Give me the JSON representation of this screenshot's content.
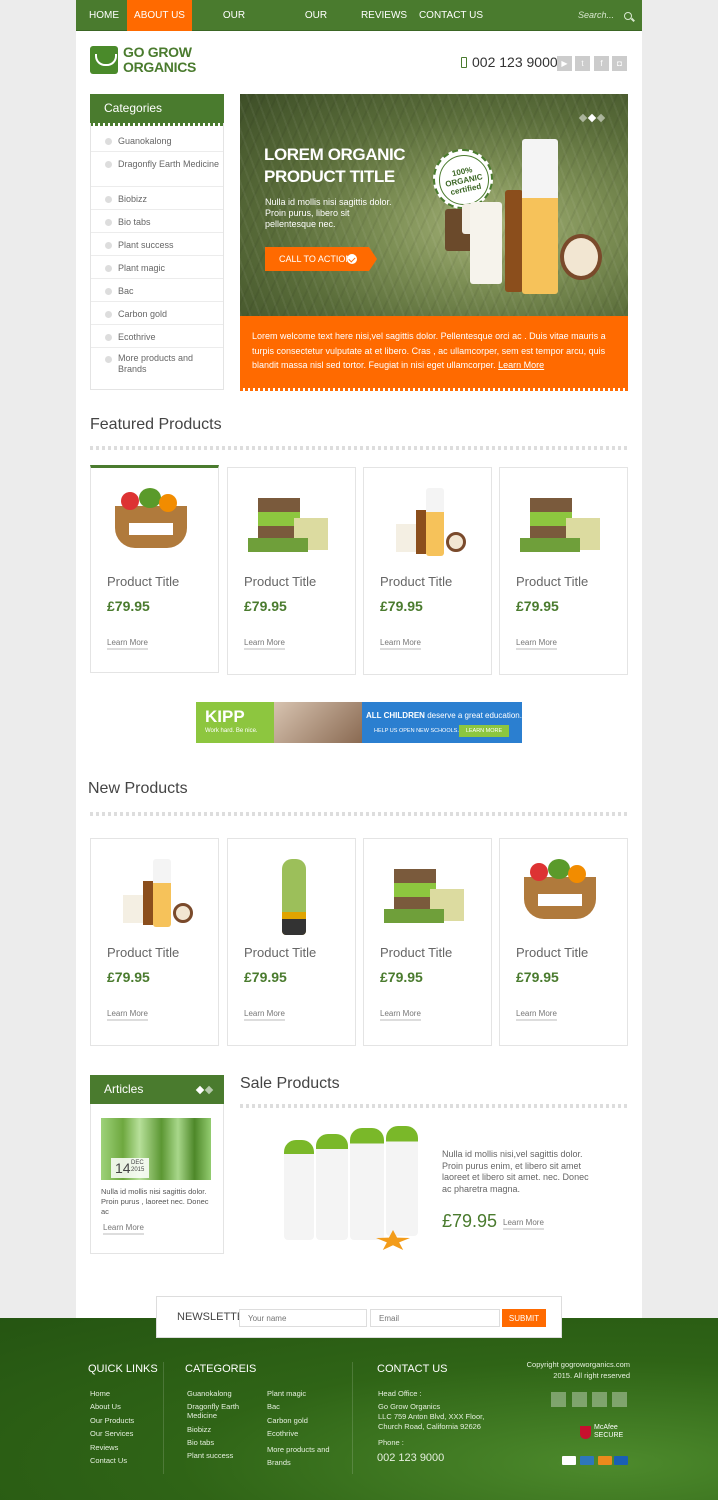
{
  "nav": {
    "items": [
      "HOME",
      "ABOUT US",
      "OUR PRODUCTS",
      "OUR SERVICES",
      "REVIEWS",
      "CONTACT US"
    ],
    "active": "ABOUT US",
    "search_placeholder": "Search..."
  },
  "header": {
    "logo_line1": "GO GROW",
    "logo_line2": "ORGANICS",
    "phone": "002 123 9000"
  },
  "sidebar": {
    "title": "Categories",
    "items": [
      "Guanokalong",
      "Dragonfly Earth Medicine",
      "Biobizz",
      "Bio tabs",
      "Plant success",
      "Plant magic",
      "Bac",
      "Carbon gold",
      "Ecothrive",
      "More products and Brands"
    ]
  },
  "hero": {
    "title": "LOREM ORGANIC PRODUCT TITLE",
    "text": "Nulla id mollis nisi sagittis dolor. Proin purus, libero sit pellentesque nec.",
    "cta": "CALL TO ACTION",
    "badge": "100% ORGANIC certified",
    "strip_text": "Lorem welcome text here  nisi,vel sagittis dolor. Pellentesque orci ac . Duis vitae mauris a turpis consectetur vulputate at et libero. Cras , ac ullamcorper, sem est tempor arcu, quis blandit massa nisl sed tortor. Feugiat in nisi eget ullamcorper.",
    "strip_link": "Learn More"
  },
  "featured": {
    "title": "Featured Products",
    "products": [
      {
        "title": "Product Title",
        "price": "£79.95",
        "link": "Learn More"
      },
      {
        "title": "Product Title",
        "price": "£79.95",
        "link": "Learn More"
      },
      {
        "title": "Product Title",
        "price": "£79.95",
        "link": "Learn More"
      },
      {
        "title": "Product Title",
        "price": "£79.95",
        "link": "Learn More"
      }
    ]
  },
  "ad": {
    "brand": "KIPP",
    "tagline": "Work hard. Be nice.",
    "headline_bold": "ALL CHILDREN",
    "headline_rest": "deserve a great education.",
    "subline": "HELP US OPEN NEW SCHOOLS.",
    "button": "LEARN MORE"
  },
  "new_products": {
    "title": "New Products",
    "products": [
      {
        "title": "Product Title",
        "price": "£79.95",
        "link": "Learn More"
      },
      {
        "title": "Product Title",
        "price": "£79.95",
        "link": "Learn More"
      },
      {
        "title": "Product Title",
        "price": "£79.95",
        "link": "Learn More"
      },
      {
        "title": "Product Title",
        "price": "£79.95",
        "link": "Learn More"
      }
    ]
  },
  "articles": {
    "title": "Articles",
    "day": "14",
    "month": "DEC",
    "year": "2015",
    "text": "Nulla id mollis nisi sagittis dolor. Proin purus , laoreet nec. Donec ac",
    "link": "Learn More"
  },
  "sale": {
    "title": "Sale Products",
    "text": "Nulla id mollis nisi,vel sagittis dolor. Proin purus enim, et libero sit amet laoreet et libero sit amet. nec. Donec ac pharetra magna.",
    "price": "£79.95",
    "link": "Learn More"
  },
  "newsletter": {
    "label": "NEWSLETTER",
    "name_placeholder": "Your name",
    "email_placeholder": "Email",
    "button": "SUBMIT"
  },
  "footer": {
    "quick_links_title": "QUICK LINKS",
    "quick_links": [
      "Home",
      "About Us",
      "Our Products",
      "Our Services",
      "Reviews",
      "Contact Us"
    ],
    "categories_title": "CATEGOREIS",
    "categories_col1": [
      "Guanokalong",
      "Dragonfly Earth Medicine",
      "Biobizz",
      "Bio tabs",
      "Plant success"
    ],
    "categories_col2": [
      "Plant magic",
      "Bac",
      "Carbon gold",
      "Ecothrive",
      "More products and Brands"
    ],
    "contact_title": "CONTACT US",
    "head_office_label": "Head Office :",
    "company": "Go Grow Organics",
    "address": "LLC 759 Anton Blvd, XXX Floor, Church Road, California 92626",
    "phone_label": "Phone :",
    "phone": "002 123 9000",
    "copyright": "Copyright gogroworganics.com 2015. All right reserved",
    "mcafee": "McAfee SECURE"
  },
  "colors": {
    "brand_green": "#4a7b2e",
    "accent_orange": "#ff6a00",
    "footer_green": "#2f6416"
  }
}
